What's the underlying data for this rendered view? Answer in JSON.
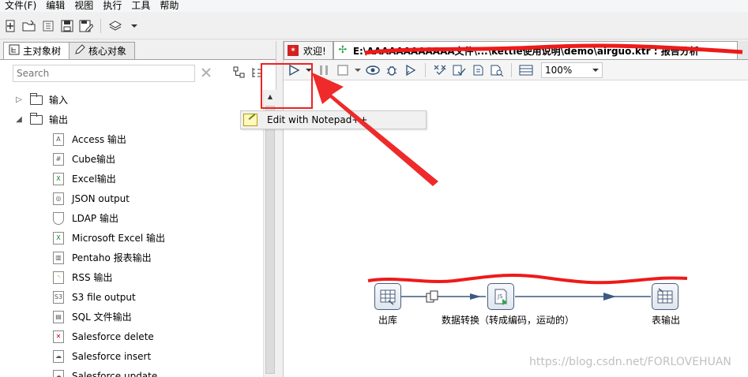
{
  "menu": {
    "items": [
      "文件(F)",
      "编辑",
      "视图",
      "执行",
      "工具",
      "帮助"
    ]
  },
  "left_panel": {
    "tabs": [
      {
        "label": "主对象树",
        "icon": "tree-icon"
      },
      {
        "label": "核心对象",
        "icon": "pencil-icon"
      }
    ],
    "search_placeholder": "Search",
    "tree": [
      {
        "type": "folder",
        "label": "输入",
        "expanded": false
      },
      {
        "type": "folder",
        "label": "输出",
        "expanded": true
      },
      {
        "type": "step",
        "label": "Access 输出",
        "icon": "access-icon"
      },
      {
        "type": "step",
        "label": "Cube输出",
        "icon": "cube-icon"
      },
      {
        "type": "step",
        "label": "Excel输出",
        "icon": "excel-icon"
      },
      {
        "type": "step",
        "label": "JSON output",
        "icon": "json-icon"
      },
      {
        "type": "step",
        "label": "LDAP 输出",
        "icon": "ldap-icon"
      },
      {
        "type": "step",
        "label": "Microsoft Excel 输出",
        "icon": "excel-icon"
      },
      {
        "type": "step",
        "label": "Pentaho 报表输出",
        "icon": "report-icon"
      },
      {
        "type": "step",
        "label": "RSS 输出",
        "icon": "rss-icon"
      },
      {
        "type": "step",
        "label": "S3 file output",
        "icon": "s3-icon"
      },
      {
        "type": "step",
        "label": "SQL 文件输出",
        "icon": "sql-icon"
      },
      {
        "type": "step",
        "label": "Salesforce delete",
        "icon": "salesforce-icon"
      },
      {
        "type": "step",
        "label": "Salesforce insert",
        "icon": "salesforce-icon"
      },
      {
        "type": "step",
        "label": "Salesforce update",
        "icon": "salesforce-icon"
      }
    ]
  },
  "context_menu": {
    "item_label": "Edit with Notepad++"
  },
  "editor": {
    "tabs": [
      {
        "label": "欢迎!",
        "icon": "welcome-icon"
      },
      {
        "label": "E:\\AAAAAAAAAAAA文件\\...\\kettle使用说明\\demo\\airguo.ktr : 报告分析",
        "icon": "transformation-icon"
      }
    ],
    "zoom": "100%"
  },
  "canvas": {
    "steps": [
      {
        "label": "出库",
        "icon": "table-input-icon"
      },
      {
        "label": "数据转换（转成编码，运动的）",
        "icon": "script-icon"
      },
      {
        "label": "表输出",
        "icon": "table-output-icon"
      }
    ],
    "hop_icon": "copy-rows-icon"
  },
  "watermark": "https://blog.csdn.net/FORLOVEHUAN",
  "colors": {
    "annotation_red": "#e22222",
    "hop_arrow": "#3d5a80"
  }
}
